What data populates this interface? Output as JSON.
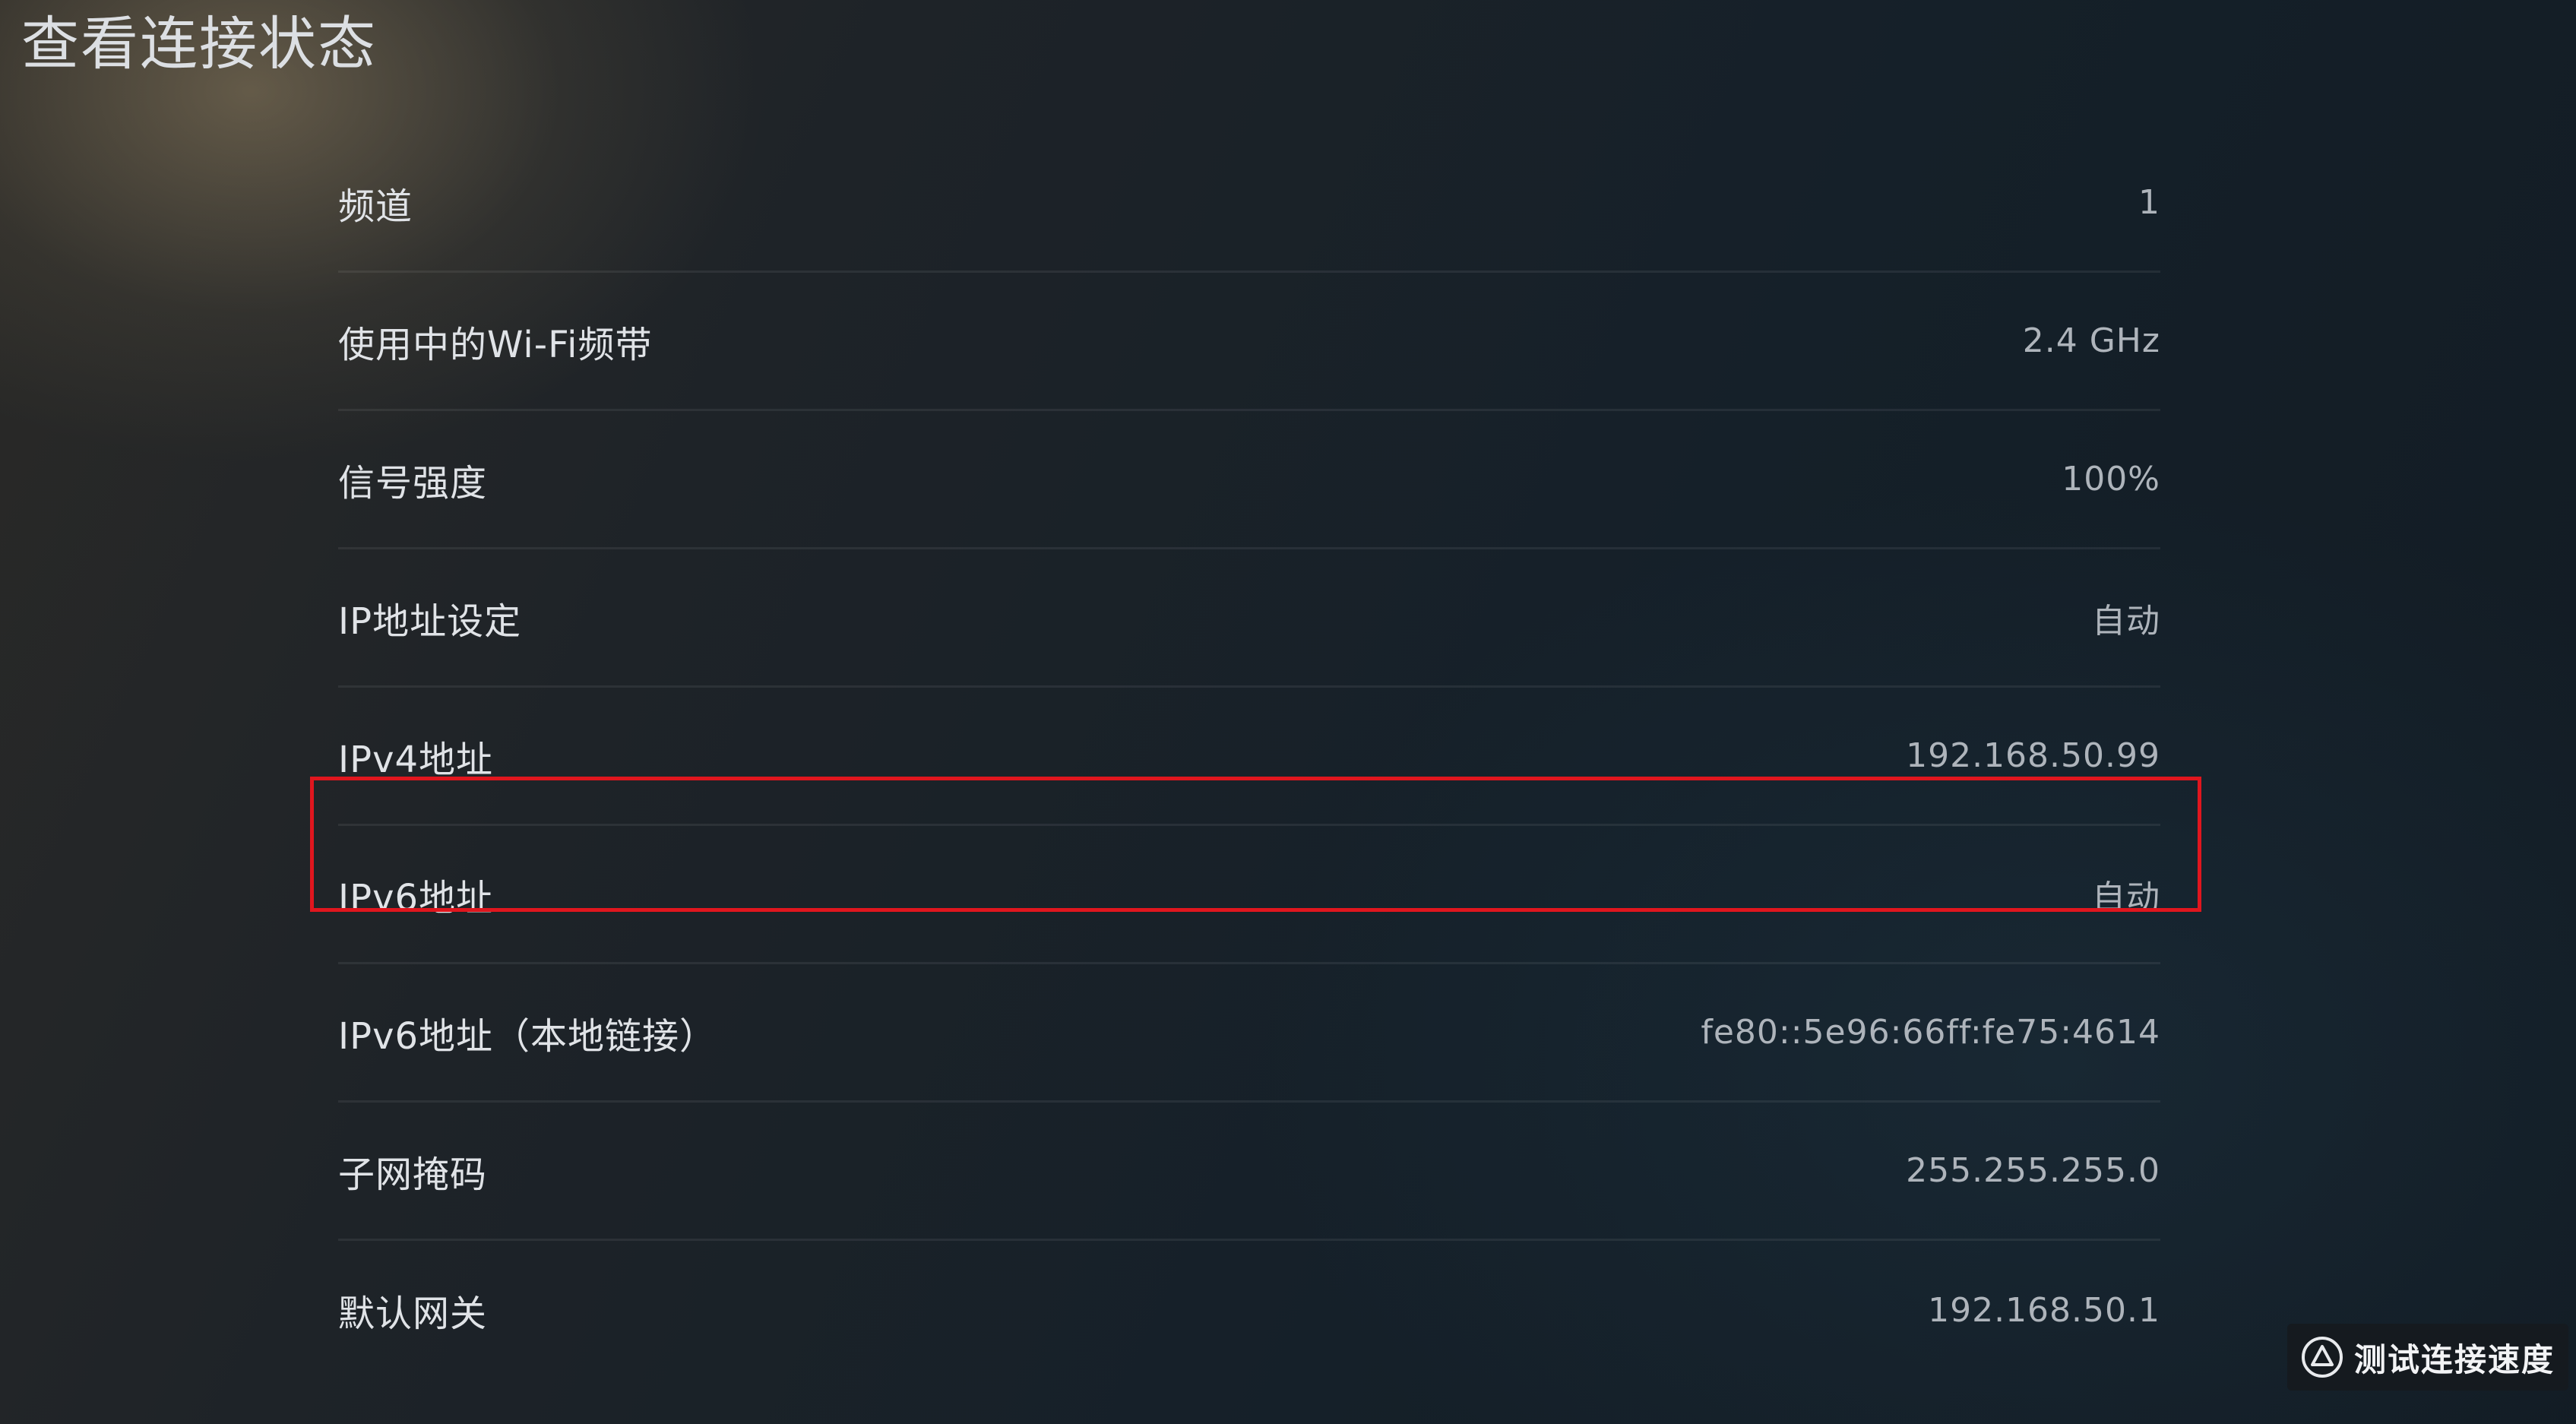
{
  "header": {
    "title": "查看连接状态"
  },
  "rows": [
    {
      "label": "频道",
      "value": "1"
    },
    {
      "label": "使用中的Wi-Fi频带",
      "value": "2.4 GHz"
    },
    {
      "label": "信号强度",
      "value": "100%"
    },
    {
      "label": "IP地址设定",
      "value": "自动"
    },
    {
      "label": "IPv4地址",
      "value": "192.168.50.99"
    },
    {
      "label": "IPv6地址",
      "value": "自动"
    },
    {
      "label": "IPv6地址（本地链接）",
      "value": "fe80::5e96:66ff:fe75:4614"
    },
    {
      "label": "子网掩码",
      "value": "255.255.255.0"
    },
    {
      "label": "默认网关",
      "value": "192.168.50.1"
    }
  ],
  "actions": {
    "test_speed_label": "测试连接速度",
    "test_speed_icon": "triangle-button-icon"
  },
  "colors": {
    "highlight": "#e0161e",
    "text": "#e0e3e7",
    "value_text": "#aeb4bb"
  }
}
